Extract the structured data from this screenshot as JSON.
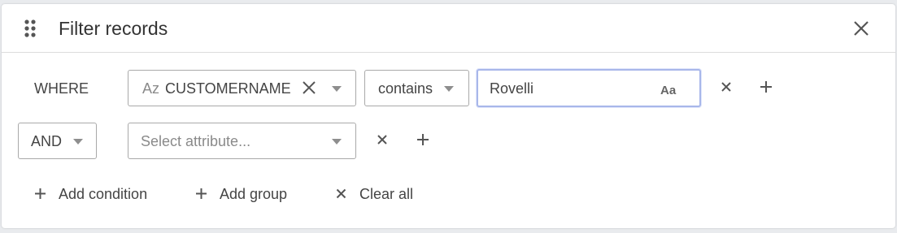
{
  "header": {
    "title": "Filter records",
    "drag_icon": "drag-handle-icon",
    "close_icon": "close-icon"
  },
  "rows": [
    {
      "operator": "WHERE",
      "attribute": {
        "type_badge": "Az",
        "value": "CUSTOMERNAME"
      },
      "comparator": {
        "value": "contains"
      },
      "value_input": {
        "value": "Rovelli",
        "case_toggle": "Aa"
      }
    },
    {
      "operator": "AND",
      "attribute": {
        "placeholder": "Select attribute..."
      }
    }
  ],
  "footer": {
    "add_condition": "Add condition",
    "add_group": "Add group",
    "clear_all": "Clear all"
  },
  "colors": {
    "background": "#e9ebee",
    "panel": "#ffffff",
    "focus_border": "#a8b7ea",
    "border": "#a9a9a9"
  }
}
